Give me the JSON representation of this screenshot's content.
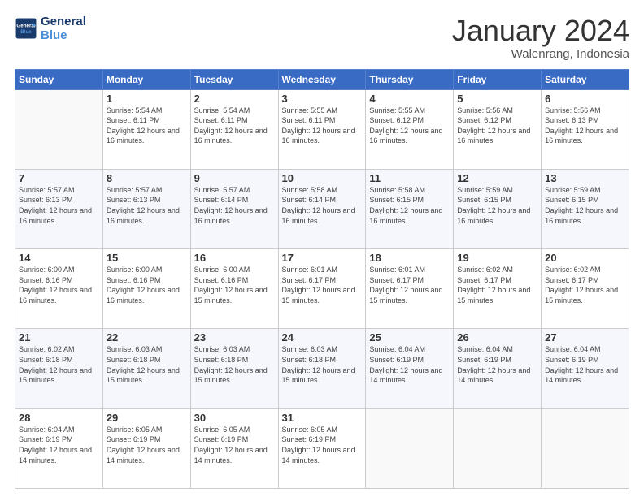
{
  "header": {
    "logo_line1": "General",
    "logo_line2": "Blue",
    "month_title": "January 2024",
    "location": "Walenrang, Indonesia"
  },
  "weekdays": [
    "Sunday",
    "Monday",
    "Tuesday",
    "Wednesday",
    "Thursday",
    "Friday",
    "Saturday"
  ],
  "weeks": [
    [
      {
        "day": "",
        "sunrise": "",
        "sunset": "",
        "daylight": ""
      },
      {
        "day": "1",
        "sunrise": "Sunrise: 5:54 AM",
        "sunset": "Sunset: 6:11 PM",
        "daylight": "Daylight: 12 hours and 16 minutes."
      },
      {
        "day": "2",
        "sunrise": "Sunrise: 5:54 AM",
        "sunset": "Sunset: 6:11 PM",
        "daylight": "Daylight: 12 hours and 16 minutes."
      },
      {
        "day": "3",
        "sunrise": "Sunrise: 5:55 AM",
        "sunset": "Sunset: 6:11 PM",
        "daylight": "Daylight: 12 hours and 16 minutes."
      },
      {
        "day": "4",
        "sunrise": "Sunrise: 5:55 AM",
        "sunset": "Sunset: 6:12 PM",
        "daylight": "Daylight: 12 hours and 16 minutes."
      },
      {
        "day": "5",
        "sunrise": "Sunrise: 5:56 AM",
        "sunset": "Sunset: 6:12 PM",
        "daylight": "Daylight: 12 hours and 16 minutes."
      },
      {
        "day": "6",
        "sunrise": "Sunrise: 5:56 AM",
        "sunset": "Sunset: 6:13 PM",
        "daylight": "Daylight: 12 hours and 16 minutes."
      }
    ],
    [
      {
        "day": "7",
        "sunrise": "Sunrise: 5:57 AM",
        "sunset": "Sunset: 6:13 PM",
        "daylight": "Daylight: 12 hours and 16 minutes."
      },
      {
        "day": "8",
        "sunrise": "Sunrise: 5:57 AM",
        "sunset": "Sunset: 6:13 PM",
        "daylight": "Daylight: 12 hours and 16 minutes."
      },
      {
        "day": "9",
        "sunrise": "Sunrise: 5:57 AM",
        "sunset": "Sunset: 6:14 PM",
        "daylight": "Daylight: 12 hours and 16 minutes."
      },
      {
        "day": "10",
        "sunrise": "Sunrise: 5:58 AM",
        "sunset": "Sunset: 6:14 PM",
        "daylight": "Daylight: 12 hours and 16 minutes."
      },
      {
        "day": "11",
        "sunrise": "Sunrise: 5:58 AM",
        "sunset": "Sunset: 6:15 PM",
        "daylight": "Daylight: 12 hours and 16 minutes."
      },
      {
        "day": "12",
        "sunrise": "Sunrise: 5:59 AM",
        "sunset": "Sunset: 6:15 PM",
        "daylight": "Daylight: 12 hours and 16 minutes."
      },
      {
        "day": "13",
        "sunrise": "Sunrise: 5:59 AM",
        "sunset": "Sunset: 6:15 PM",
        "daylight": "Daylight: 12 hours and 16 minutes."
      }
    ],
    [
      {
        "day": "14",
        "sunrise": "Sunrise: 6:00 AM",
        "sunset": "Sunset: 6:16 PM",
        "daylight": "Daylight: 12 hours and 16 minutes."
      },
      {
        "day": "15",
        "sunrise": "Sunrise: 6:00 AM",
        "sunset": "Sunset: 6:16 PM",
        "daylight": "Daylight: 12 hours and 16 minutes."
      },
      {
        "day": "16",
        "sunrise": "Sunrise: 6:00 AM",
        "sunset": "Sunset: 6:16 PM",
        "daylight": "Daylight: 12 hours and 15 minutes."
      },
      {
        "day": "17",
        "sunrise": "Sunrise: 6:01 AM",
        "sunset": "Sunset: 6:17 PM",
        "daylight": "Daylight: 12 hours and 15 minutes."
      },
      {
        "day": "18",
        "sunrise": "Sunrise: 6:01 AM",
        "sunset": "Sunset: 6:17 PM",
        "daylight": "Daylight: 12 hours and 15 minutes."
      },
      {
        "day": "19",
        "sunrise": "Sunrise: 6:02 AM",
        "sunset": "Sunset: 6:17 PM",
        "daylight": "Daylight: 12 hours and 15 minutes."
      },
      {
        "day": "20",
        "sunrise": "Sunrise: 6:02 AM",
        "sunset": "Sunset: 6:17 PM",
        "daylight": "Daylight: 12 hours and 15 minutes."
      }
    ],
    [
      {
        "day": "21",
        "sunrise": "Sunrise: 6:02 AM",
        "sunset": "Sunset: 6:18 PM",
        "daylight": "Daylight: 12 hours and 15 minutes."
      },
      {
        "day": "22",
        "sunrise": "Sunrise: 6:03 AM",
        "sunset": "Sunset: 6:18 PM",
        "daylight": "Daylight: 12 hours and 15 minutes."
      },
      {
        "day": "23",
        "sunrise": "Sunrise: 6:03 AM",
        "sunset": "Sunset: 6:18 PM",
        "daylight": "Daylight: 12 hours and 15 minutes."
      },
      {
        "day": "24",
        "sunrise": "Sunrise: 6:03 AM",
        "sunset": "Sunset: 6:18 PM",
        "daylight": "Daylight: 12 hours and 15 minutes."
      },
      {
        "day": "25",
        "sunrise": "Sunrise: 6:04 AM",
        "sunset": "Sunset: 6:19 PM",
        "daylight": "Daylight: 12 hours and 14 minutes."
      },
      {
        "day": "26",
        "sunrise": "Sunrise: 6:04 AM",
        "sunset": "Sunset: 6:19 PM",
        "daylight": "Daylight: 12 hours and 14 minutes."
      },
      {
        "day": "27",
        "sunrise": "Sunrise: 6:04 AM",
        "sunset": "Sunset: 6:19 PM",
        "daylight": "Daylight: 12 hours and 14 minutes."
      }
    ],
    [
      {
        "day": "28",
        "sunrise": "Sunrise: 6:04 AM",
        "sunset": "Sunset: 6:19 PM",
        "daylight": "Daylight: 12 hours and 14 minutes."
      },
      {
        "day": "29",
        "sunrise": "Sunrise: 6:05 AM",
        "sunset": "Sunset: 6:19 PM",
        "daylight": "Daylight: 12 hours and 14 minutes."
      },
      {
        "day": "30",
        "sunrise": "Sunrise: 6:05 AM",
        "sunset": "Sunset: 6:19 PM",
        "daylight": "Daylight: 12 hours and 14 minutes."
      },
      {
        "day": "31",
        "sunrise": "Sunrise: 6:05 AM",
        "sunset": "Sunset: 6:19 PM",
        "daylight": "Daylight: 12 hours and 14 minutes."
      },
      {
        "day": "",
        "sunrise": "",
        "sunset": "",
        "daylight": ""
      },
      {
        "day": "",
        "sunrise": "",
        "sunset": "",
        "daylight": ""
      },
      {
        "day": "",
        "sunrise": "",
        "sunset": "",
        "daylight": ""
      }
    ]
  ]
}
